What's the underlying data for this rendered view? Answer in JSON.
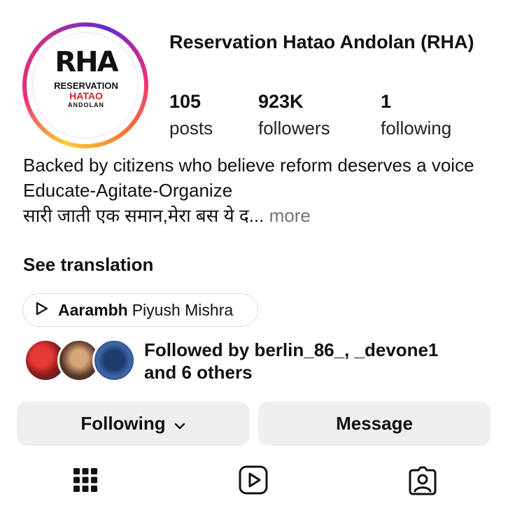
{
  "profile": {
    "name": "Reservation Hatao Andolan (RHA)",
    "avatar_logo": {
      "initials": "RHA",
      "line1": "RESERVATION",
      "line2": "HATAO",
      "line3": "ANDOLAN"
    }
  },
  "stats": {
    "posts": {
      "value": "105",
      "label": "posts"
    },
    "followers": {
      "value": "923K",
      "label": "followers"
    },
    "following": {
      "value": "1",
      "label": "following"
    }
  },
  "bio": {
    "line1": "Backed by citizens who believe reform deserves a voice",
    "line2": "Educate-Agitate-Organize",
    "line3": "सारी जाती एक समान,मेरा बस ये द...",
    "more": "more",
    "see_translation": "See translation"
  },
  "music": {
    "icon": "play-icon",
    "song": "Aarambh",
    "artist": "Piyush Mishra"
  },
  "followed_by": {
    "text_line1": "Followed by berlin_86_, _devone1",
    "text_line2": "and 6 others"
  },
  "actions": {
    "following_label": "Following",
    "message_label": "Message"
  },
  "tabs": [
    "grid-icon",
    "reels-icon",
    "tagged-icon"
  ],
  "colors": {
    "button_bg": "#efeff2",
    "muted_text": "#737373",
    "logo_red": "#c62828"
  }
}
